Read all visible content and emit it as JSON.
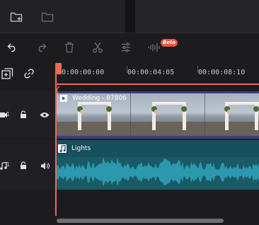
{
  "toolbar": {
    "icons": [
      "undo-icon",
      "redo-icon",
      "delete-icon",
      "cut-icon",
      "adjust-icon",
      "audio-wave-icon"
    ],
    "beta_label": "Beta"
  },
  "media_panel": {
    "icons": [
      "new-folder-icon",
      "folder-icon"
    ]
  },
  "track_header": {
    "icons": [
      "add-track-icon",
      "link-icon"
    ]
  },
  "ruler": {
    "timecodes": [
      "00:00:00:00",
      "00:00:04:05",
      "00:00:08:10"
    ]
  },
  "tracks": {
    "video": {
      "number": "1",
      "clip_title": "Wedding - 87806"
    },
    "audio": {
      "number": "1",
      "clip_title": "Lights"
    }
  },
  "colors": {
    "playhead": "#ef6a53",
    "video_clip": "#3a3f7c",
    "audio_clip": "#1a5966",
    "waveform": "#2b98ad",
    "beta": "#e8573b"
  }
}
